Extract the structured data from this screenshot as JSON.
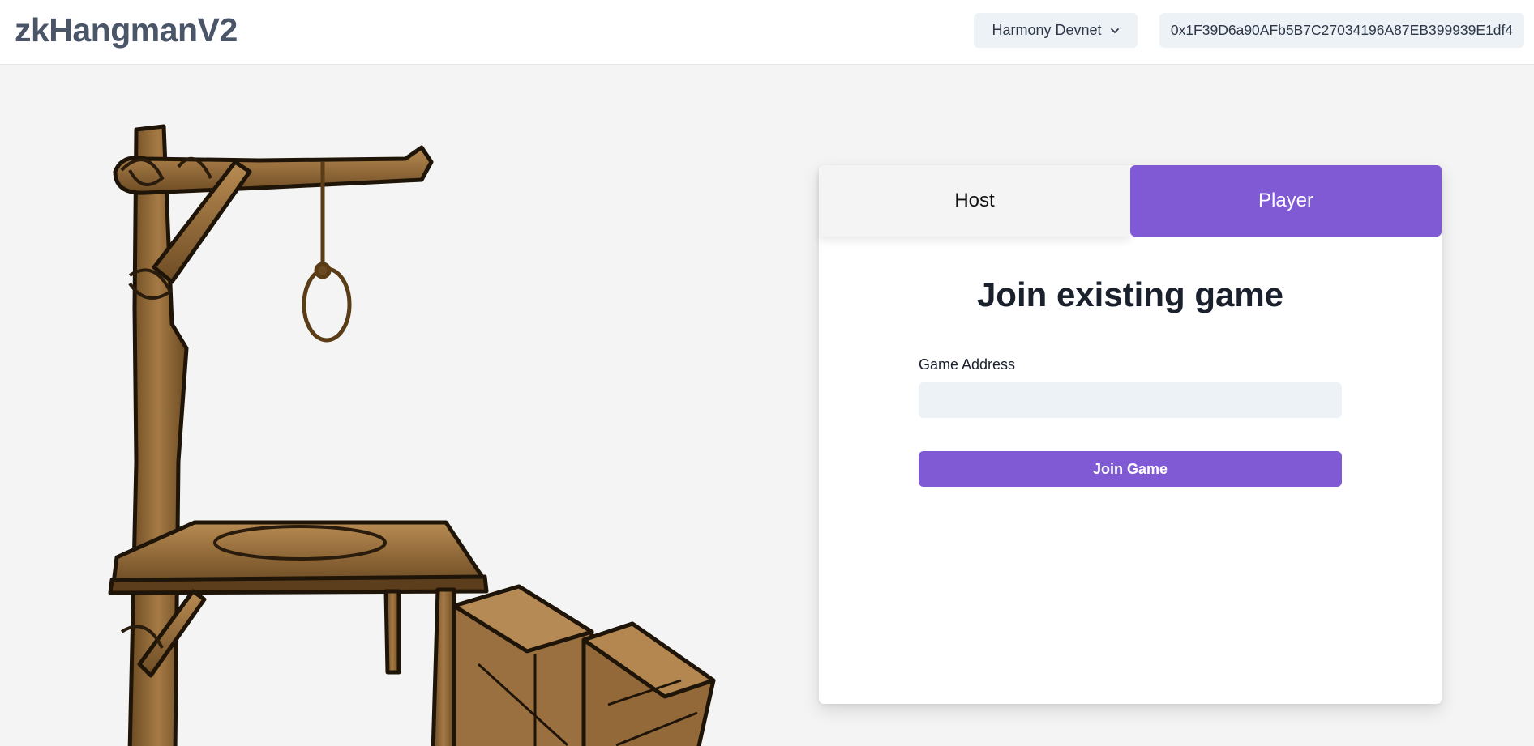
{
  "app": {
    "title": "zkHangmanV2"
  },
  "header": {
    "network_label": "Harmony Devnet",
    "wallet_address": "0x1F39D6a90AFb5B7C27034196A87EB399939E1df4"
  },
  "card": {
    "tabs": [
      {
        "label": "Host",
        "active": false
      },
      {
        "label": "Player",
        "active": true
      }
    ],
    "heading": "Join existing game",
    "game_address_label": "Game Address",
    "game_address_value": "",
    "join_button_label": "Join Game"
  },
  "colors": {
    "accent": "#805ad5",
    "input_bg": "#edf2f7",
    "page_bg": "#f4f4f4",
    "title": "#4a5568",
    "wood": "#8b6436"
  },
  "icons": {
    "network_dropdown": "chevron-down-icon",
    "illustration": "gallows-illustration"
  }
}
